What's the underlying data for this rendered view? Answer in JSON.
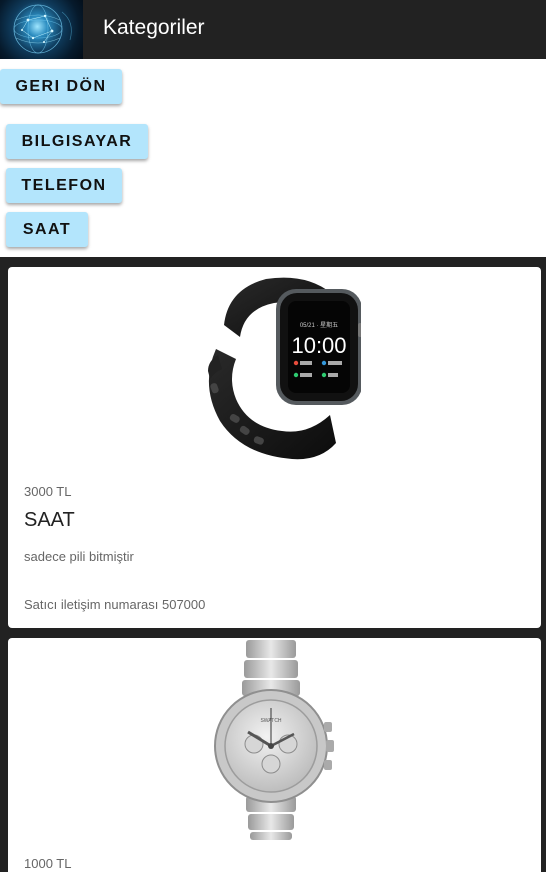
{
  "header": {
    "title": "Kategoriler",
    "logo_icon": "globe-network-icon"
  },
  "back_button": {
    "label": "GERI DÖN"
  },
  "categories": [
    {
      "label": "BILGISAYAR"
    },
    {
      "label": "TELEFON"
    },
    {
      "label": "SAAT"
    }
  ],
  "products": [
    {
      "image_icon": "smartwatch-black-icon",
      "screen_time": "10:00",
      "price": "3000 TL",
      "title": "SAAT",
      "description": "sadece pili bitmiştir",
      "contact": "Satıcı iletişim numarası 507000"
    },
    {
      "image_icon": "silver-wristwatch-icon",
      "price": "1000 TL"
    }
  ],
  "colors": {
    "header_bg": "#222222",
    "button_bg": "#b3e5fc",
    "list_bg": "#222222",
    "card_bg": "#ffffff"
  }
}
